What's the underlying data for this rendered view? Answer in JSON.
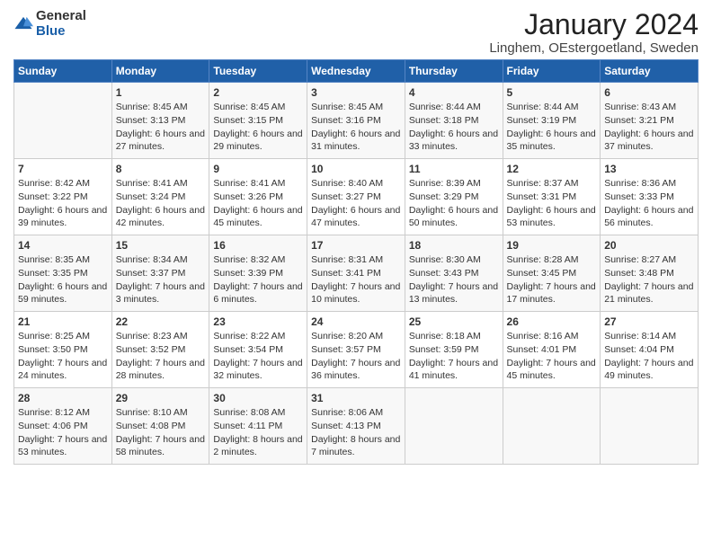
{
  "logo": {
    "general": "General",
    "blue": "Blue"
  },
  "title": "January 2024",
  "subtitle": "Linghem, OEstergoetland, Sweden",
  "header": {
    "days": [
      "Sunday",
      "Monday",
      "Tuesday",
      "Wednesday",
      "Thursday",
      "Friday",
      "Saturday"
    ]
  },
  "weeks": [
    [
      {
        "day": "",
        "sunrise": "",
        "sunset": "",
        "daylight": ""
      },
      {
        "day": "1",
        "sunrise": "Sunrise: 8:45 AM",
        "sunset": "Sunset: 3:13 PM",
        "daylight": "Daylight: 6 hours and 27 minutes."
      },
      {
        "day": "2",
        "sunrise": "Sunrise: 8:45 AM",
        "sunset": "Sunset: 3:15 PM",
        "daylight": "Daylight: 6 hours and 29 minutes."
      },
      {
        "day": "3",
        "sunrise": "Sunrise: 8:45 AM",
        "sunset": "Sunset: 3:16 PM",
        "daylight": "Daylight: 6 hours and 31 minutes."
      },
      {
        "day": "4",
        "sunrise": "Sunrise: 8:44 AM",
        "sunset": "Sunset: 3:18 PM",
        "daylight": "Daylight: 6 hours and 33 minutes."
      },
      {
        "day": "5",
        "sunrise": "Sunrise: 8:44 AM",
        "sunset": "Sunset: 3:19 PM",
        "daylight": "Daylight: 6 hours and 35 minutes."
      },
      {
        "day": "6",
        "sunrise": "Sunrise: 8:43 AM",
        "sunset": "Sunset: 3:21 PM",
        "daylight": "Daylight: 6 hours and 37 minutes."
      }
    ],
    [
      {
        "day": "7",
        "sunrise": "Sunrise: 8:42 AM",
        "sunset": "Sunset: 3:22 PM",
        "daylight": "Daylight: 6 hours and 39 minutes."
      },
      {
        "day": "8",
        "sunrise": "Sunrise: 8:41 AM",
        "sunset": "Sunset: 3:24 PM",
        "daylight": "Daylight: 6 hours and 42 minutes."
      },
      {
        "day": "9",
        "sunrise": "Sunrise: 8:41 AM",
        "sunset": "Sunset: 3:26 PM",
        "daylight": "Daylight: 6 hours and 45 minutes."
      },
      {
        "day": "10",
        "sunrise": "Sunrise: 8:40 AM",
        "sunset": "Sunset: 3:27 PM",
        "daylight": "Daylight: 6 hours and 47 minutes."
      },
      {
        "day": "11",
        "sunrise": "Sunrise: 8:39 AM",
        "sunset": "Sunset: 3:29 PM",
        "daylight": "Daylight: 6 hours and 50 minutes."
      },
      {
        "day": "12",
        "sunrise": "Sunrise: 8:37 AM",
        "sunset": "Sunset: 3:31 PM",
        "daylight": "Daylight: 6 hours and 53 minutes."
      },
      {
        "day": "13",
        "sunrise": "Sunrise: 8:36 AM",
        "sunset": "Sunset: 3:33 PM",
        "daylight": "Daylight: 6 hours and 56 minutes."
      }
    ],
    [
      {
        "day": "14",
        "sunrise": "Sunrise: 8:35 AM",
        "sunset": "Sunset: 3:35 PM",
        "daylight": "Daylight: 6 hours and 59 minutes."
      },
      {
        "day": "15",
        "sunrise": "Sunrise: 8:34 AM",
        "sunset": "Sunset: 3:37 PM",
        "daylight": "Daylight: 7 hours and 3 minutes."
      },
      {
        "day": "16",
        "sunrise": "Sunrise: 8:32 AM",
        "sunset": "Sunset: 3:39 PM",
        "daylight": "Daylight: 7 hours and 6 minutes."
      },
      {
        "day": "17",
        "sunrise": "Sunrise: 8:31 AM",
        "sunset": "Sunset: 3:41 PM",
        "daylight": "Daylight: 7 hours and 10 minutes."
      },
      {
        "day": "18",
        "sunrise": "Sunrise: 8:30 AM",
        "sunset": "Sunset: 3:43 PM",
        "daylight": "Daylight: 7 hours and 13 minutes."
      },
      {
        "day": "19",
        "sunrise": "Sunrise: 8:28 AM",
        "sunset": "Sunset: 3:45 PM",
        "daylight": "Daylight: 7 hours and 17 minutes."
      },
      {
        "day": "20",
        "sunrise": "Sunrise: 8:27 AM",
        "sunset": "Sunset: 3:48 PM",
        "daylight": "Daylight: 7 hours and 21 minutes."
      }
    ],
    [
      {
        "day": "21",
        "sunrise": "Sunrise: 8:25 AM",
        "sunset": "Sunset: 3:50 PM",
        "daylight": "Daylight: 7 hours and 24 minutes."
      },
      {
        "day": "22",
        "sunrise": "Sunrise: 8:23 AM",
        "sunset": "Sunset: 3:52 PM",
        "daylight": "Daylight: 7 hours and 28 minutes."
      },
      {
        "day": "23",
        "sunrise": "Sunrise: 8:22 AM",
        "sunset": "Sunset: 3:54 PM",
        "daylight": "Daylight: 7 hours and 32 minutes."
      },
      {
        "day": "24",
        "sunrise": "Sunrise: 8:20 AM",
        "sunset": "Sunset: 3:57 PM",
        "daylight": "Daylight: 7 hours and 36 minutes."
      },
      {
        "day": "25",
        "sunrise": "Sunrise: 8:18 AM",
        "sunset": "Sunset: 3:59 PM",
        "daylight": "Daylight: 7 hours and 41 minutes."
      },
      {
        "day": "26",
        "sunrise": "Sunrise: 8:16 AM",
        "sunset": "Sunset: 4:01 PM",
        "daylight": "Daylight: 7 hours and 45 minutes."
      },
      {
        "day": "27",
        "sunrise": "Sunrise: 8:14 AM",
        "sunset": "Sunset: 4:04 PM",
        "daylight": "Daylight: 7 hours and 49 minutes."
      }
    ],
    [
      {
        "day": "28",
        "sunrise": "Sunrise: 8:12 AM",
        "sunset": "Sunset: 4:06 PM",
        "daylight": "Daylight: 7 hours and 53 minutes."
      },
      {
        "day": "29",
        "sunrise": "Sunrise: 8:10 AM",
        "sunset": "Sunset: 4:08 PM",
        "daylight": "Daylight: 7 hours and 58 minutes."
      },
      {
        "day": "30",
        "sunrise": "Sunrise: 8:08 AM",
        "sunset": "Sunset: 4:11 PM",
        "daylight": "Daylight: 8 hours and 2 minutes."
      },
      {
        "day": "31",
        "sunrise": "Sunrise: 8:06 AM",
        "sunset": "Sunset: 4:13 PM",
        "daylight": "Daylight: 8 hours and 7 minutes."
      },
      {
        "day": "",
        "sunrise": "",
        "sunset": "",
        "daylight": ""
      },
      {
        "day": "",
        "sunrise": "",
        "sunset": "",
        "daylight": ""
      },
      {
        "day": "",
        "sunrise": "",
        "sunset": "",
        "daylight": ""
      }
    ]
  ]
}
